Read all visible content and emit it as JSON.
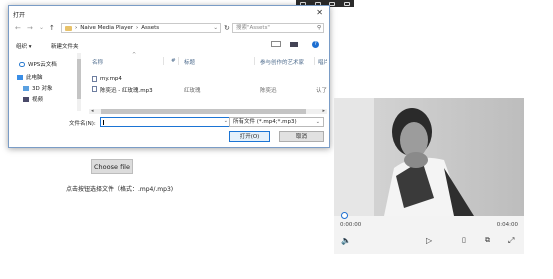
{
  "dialog": {
    "title": "打开",
    "close": "✕",
    "nav": {
      "back": "←",
      "forward": "→",
      "up_arrow": "⌄",
      "up": "↑"
    },
    "breadcrumb": [
      "Naive Media Player",
      "Assets"
    ],
    "breadcrumb_sep": "›",
    "refresh": "↻",
    "search_placeholder": "搜索\"Assets\"",
    "toolbar": {
      "organize": "组织 ▾",
      "new_folder": "新建文件夹",
      "help": "?"
    },
    "sidebar": [
      {
        "label": "WPS云文档",
        "icon": "cloud-icon"
      },
      {
        "label": "此电脑",
        "icon": "computer-icon"
      },
      {
        "label": "3D 对象",
        "icon": "cube-icon"
      },
      {
        "label": "视频",
        "icon": "video-folder-icon"
      }
    ],
    "columns": [
      "名称",
      "#",
      "标题",
      "参与创作的艺术家",
      "唱片"
    ],
    "files": [
      {
        "name": "my.mp4",
        "title": "",
        "artist": "",
        "extra": ""
      },
      {
        "name": "陈奕迅 - 红玫瑰.mp3",
        "title": "红玫瑰",
        "artist": "陈奕迅",
        "extra": "认了"
      }
    ],
    "filename_label": "文件名(N):",
    "filename_value": "",
    "filetype": "所有文件 (*.mp4;*.mp3)",
    "open_button": "打开(O)",
    "cancel_button": "取消"
  },
  "page": {
    "choose_button": "Choose file",
    "hint": "点击按钮选择文件（格式：.mp4/.mp3)"
  },
  "player": {
    "current_time": "0:00:00",
    "duration": "0:04:00",
    "progress": 0
  },
  "colors": {
    "accent": "#1e6fd1",
    "dialog_border": "#7a9cc6"
  }
}
